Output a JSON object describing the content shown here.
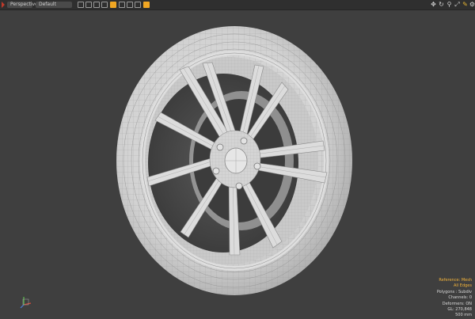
{
  "toolbar": {
    "view_mode": "Perspective",
    "shading_mode": "Default",
    "icons": [
      "grid-icon",
      "wire-icon",
      "solid-icon",
      "texture-icon",
      "active-shade-icon",
      "material-icon",
      "light-icon",
      "camera-icon",
      "lock-icon"
    ],
    "nav_icons": [
      "move-icon",
      "rotate-icon",
      "zoom-icon",
      "fit-icon",
      "measure-icon",
      "settings-icon"
    ],
    "accent_color": "#f0a623"
  },
  "stats": {
    "reference": "Reference: Mesh",
    "edges": "All Edges",
    "polygons": "Polygons : Subdiv",
    "channels": "Channels: 0",
    "deformers": "Deformers: ON",
    "gl": "GL: 270,848",
    "units": "500 mm"
  },
  "colors": {
    "viewport_bg": "#3f3f3f",
    "mesh_fill": "#d8d8d8",
    "wire": "#8e8e8e",
    "highlight": "#f2b33a"
  }
}
